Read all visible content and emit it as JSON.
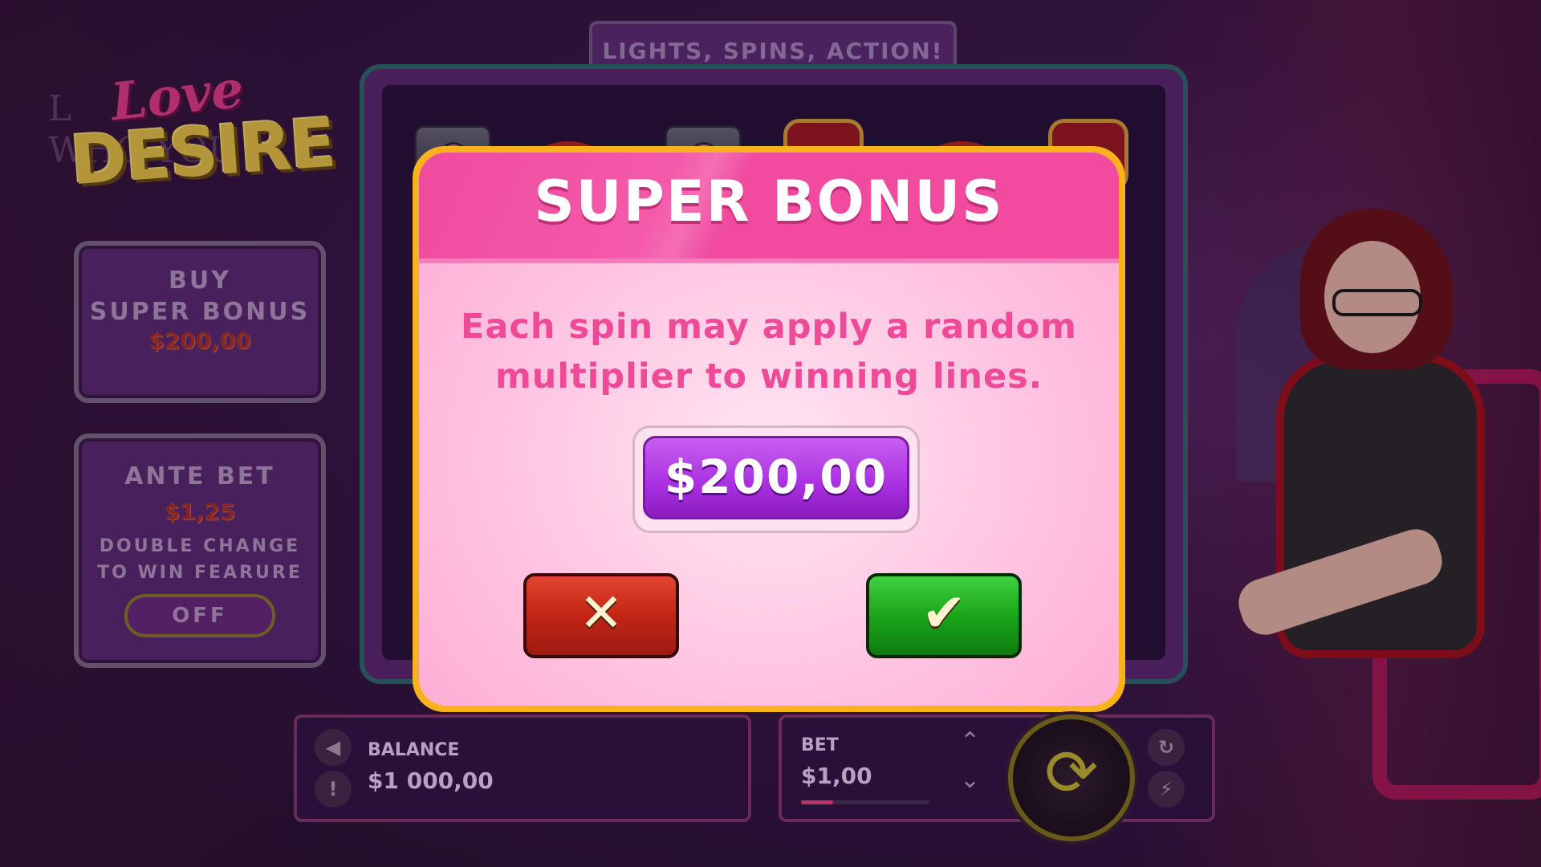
{
  "banner": {
    "text": "LIGHTS, SPINS, ACTION!"
  },
  "logo": {
    "love": "Love",
    "desire": "DESIRE"
  },
  "background": {
    "wall_text_1": "L",
    "wall_text_2": "WHO YOU"
  },
  "buy_panel": {
    "line1": "BUY",
    "line2": "SUPER BONUS",
    "price": "$200,00"
  },
  "ante_panel": {
    "title": "ANTE BET",
    "price": "$1,25",
    "note_line1": "DOUBLE CHANGE",
    "note_line2": "TO WIN FEARURE",
    "toggle": "OFF"
  },
  "reels": {
    "symbols": [
      "camera-icon",
      "ring-icon",
      "camera-icon",
      "heart-icon",
      "ring-icon",
      "heart-icon"
    ]
  },
  "modal": {
    "title": "SUPER BONUS",
    "text_line1": "Each spin may apply a random",
    "text_line2": "multiplier to winning lines.",
    "price": "$200,00",
    "cancel_icon": "close-icon",
    "confirm_icon": "check-icon"
  },
  "bottom_bar": {
    "balance_label": "BALANCE",
    "balance_value": "$1 000,00",
    "bet_label": "BET",
    "bet_value": "$1,00",
    "bet_level": 0.25,
    "icons": [
      "sound-icon",
      "info-icon",
      "arrow-up-icon",
      "arrow-down-icon",
      "spin-icon",
      "autoplay-icon",
      "turbo-icon"
    ]
  },
  "colors": {
    "modal_border": "#f9b21e",
    "modal_header": "#f04b9e",
    "modal_text": "#ee4a98",
    "price_button": "#a92fe0",
    "cancel": "#c22516",
    "confirm": "#1aa61a"
  }
}
